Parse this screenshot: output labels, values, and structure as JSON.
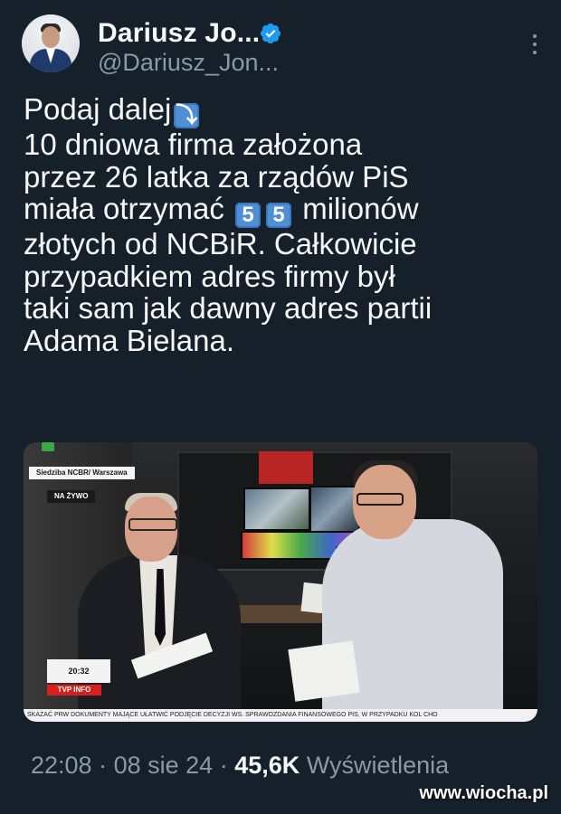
{
  "author": {
    "name": "Dariusz Jo...",
    "handle": "@Dariusz_Jon..."
  },
  "tweet": {
    "line1": "Podaj dalej",
    "line1_emoji": "⤵",
    "line2": "10 dniowa firma założona",
    "line3": "przez 26 latka za rządów PiS",
    "line4_pre": "miała otrzymać",
    "emoji_digit_1": "5",
    "emoji_digit_2": "5",
    "line4_post": "milionów",
    "line5": "złotych od NCBiR. Całkowicie",
    "line6": "przypadkiem adres firmy był",
    "line7": "taki sam jak dawny adres partii",
    "line8": "Adama Bielana."
  },
  "media": {
    "location_label": "Siedziba NCBR/ Warszawa",
    "live_label": "NA ŻYWO",
    "clock": "20:32",
    "channel": "TVP INFO",
    "ticker": "SKAZAĆ PRW DOKUMENTY MAJĄCE UŁATWIĆ PODJĘCIE DECYZJI WS. SPRAWOZDANIA FINANSOWEGO PIS, W PRZYPADKU KOL CHO"
  },
  "meta": {
    "time": "22:08",
    "sep1": "·",
    "date": "08 sie 24",
    "sep2": "·",
    "views_count": "45,6K",
    "views_label": "Wyświetlenia"
  },
  "watermark": "www.wiocha.pl",
  "colors": {
    "background": "#15202b",
    "text": "#f7f9f9",
    "secondary": "#8b98a5",
    "verified": "#1d9bf0"
  }
}
